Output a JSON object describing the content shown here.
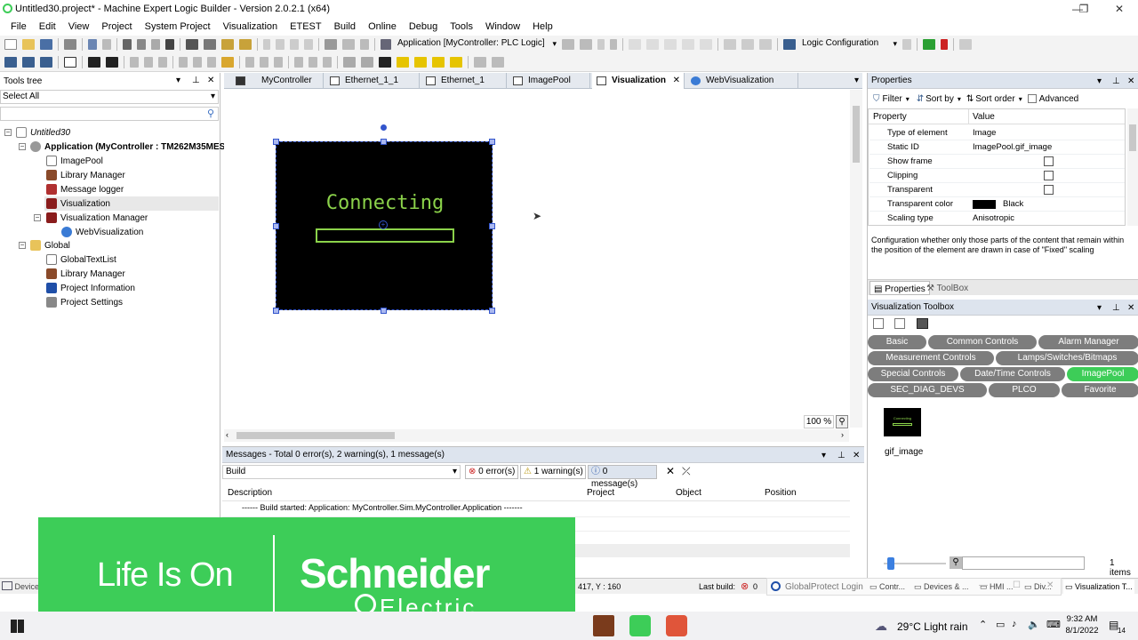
{
  "window": {
    "title": "Untitled30.project* - Machine Expert Logic Builder - Version 2.0.2.1 (x64)"
  },
  "menu": [
    "File",
    "Edit",
    "View",
    "Project",
    "System Project",
    "Visualization",
    "ETEST",
    "Build",
    "Online",
    "Debug",
    "Tools",
    "Window",
    "Help"
  ],
  "toolbar": {
    "app_combo": "Application [MyController: PLC Logic]",
    "config_combo": "Logic Configuration"
  },
  "tools_tree": {
    "title": "Tools tree",
    "filter": "Select All",
    "nodes": [
      {
        "label": "Untitled30",
        "italic": true
      },
      {
        "label": "Application (MyController : TM262M35MESE8T)",
        "bold": true
      },
      {
        "label": "ImagePool"
      },
      {
        "label": "Library Manager"
      },
      {
        "label": "Message logger"
      },
      {
        "label": "Visualization"
      },
      {
        "label": "Visualization Manager"
      },
      {
        "label": "WebVisualization"
      },
      {
        "label": "Global"
      },
      {
        "label": "GlobalTextList"
      },
      {
        "label": "Library Manager"
      },
      {
        "label": "Project Information"
      },
      {
        "label": "Project Settings"
      }
    ]
  },
  "editor_tabs": [
    "MyController",
    "Ethernet_1_1",
    "Ethernet_1",
    "ImagePool",
    "Visualization",
    "WebVisualization"
  ],
  "canvas": {
    "image_text": "Connecting",
    "zoom": "100 %"
  },
  "properties": {
    "title": "Properties",
    "filter_label": "Filter",
    "sort_by": "Sort by",
    "sort_order": "Sort order",
    "advanced": "Advanced",
    "col_property": "Property",
    "col_value": "Value",
    "rows": [
      {
        "name": "Type of element",
        "value": "Image"
      },
      {
        "name": "Static ID",
        "value": "ImagePool.gif_image"
      },
      {
        "name": "Show frame",
        "value": ""
      },
      {
        "name": "Clipping",
        "value": ""
      },
      {
        "name": "Transparent",
        "value": ""
      },
      {
        "name": "Transparent color",
        "value": "Black"
      },
      {
        "name": "Scaling type",
        "value": "Anisotropic"
      }
    ],
    "description": "Configuration whether only those parts of the content that remain within the position of the element are drawn in case of \"Fixed\" scaling",
    "tab_properties": "Properties",
    "tab_toolbox": "ToolBox"
  },
  "toolbox": {
    "title": "Visualization Toolbox",
    "categories": [
      "Basic",
      "Common Controls",
      "Alarm Manager",
      "Measurement Controls",
      "Lamps/Switches/Bitmaps",
      "Special Controls",
      "Date/Time Controls",
      "ImagePool",
      "SEC_DIAG_DEVS",
      "PLCO",
      "Favorite"
    ],
    "item_label": "gif_image",
    "item_count": "1 items"
  },
  "messages": {
    "title": "Messages - Total 0 error(s), 2 warning(s), 1 message(s)",
    "source": "Build",
    "errors": "0 error(s)",
    "warnings": "1 warning(s)",
    "messages": "0 message(s)",
    "columns": [
      "Description",
      "Project",
      "Object",
      "Position"
    ],
    "line": "------ Build started: Application: MyController.Sim.MyController.Application -------"
  },
  "banner": {
    "tagline": "Life Is On",
    "brand": "Schneider",
    "brand_sub": "Electric"
  },
  "status": {
    "devices": "Device",
    "coords": "417, Y : 160",
    "last_build": "Last build:",
    "last_build_count": "0",
    "gp": "GlobalProtect Login",
    "tabs": [
      "Contr...",
      "Devices & ...",
      "HMI ...",
      "Div...",
      "Visualization T..."
    ]
  },
  "taskbar": {
    "weather": "29°C  Light rain",
    "time": "9:32 AM",
    "date": "8/1/2022",
    "notif": "14"
  },
  "colors": {
    "accent_green": "#3dcd58",
    "canvas_bg": "#000000",
    "lcd_green": "#8bd24a",
    "header": "#dde4ee"
  }
}
